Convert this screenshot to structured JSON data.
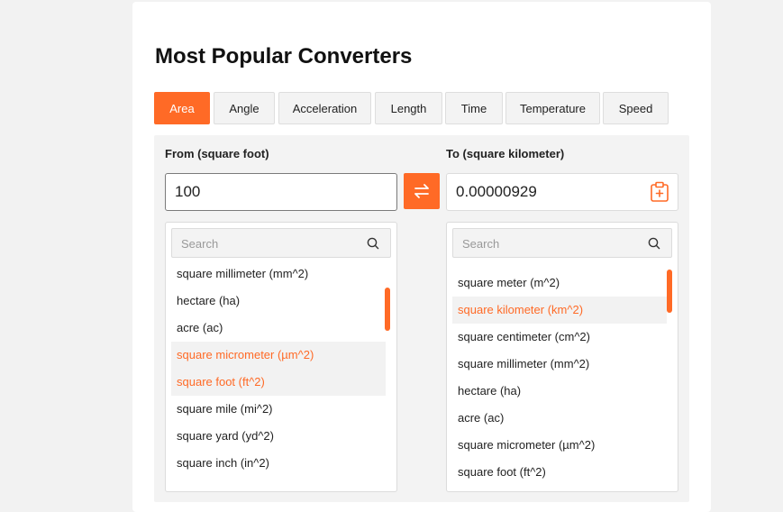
{
  "title": "Most Popular Converters",
  "tabs": [
    "Area",
    "Angle",
    "Acceleration",
    "Length",
    "Time",
    "Temperature",
    "Speed"
  ],
  "active_tab": "Area",
  "from": {
    "label": "From (square foot)",
    "value": "100",
    "search_placeholder": "Search",
    "items": [
      "square millimeter (mm^2)",
      "hectare (ha)",
      "acre (ac)",
      "square micrometer (µm^2)",
      "square foot (ft^2)",
      "square mile (mi^2)",
      "square yard (yd^2)",
      "square inch (in^2)"
    ],
    "highlighted": [
      "square micrometer (µm^2)",
      "square foot (ft^2)"
    ]
  },
  "to": {
    "label": "To (square kilometer)",
    "value": "0.00000929",
    "search_placeholder": "Search",
    "items": [
      "square meter (m^2)",
      "square kilometer (km^2)",
      "square centimeter (cm^2)",
      "square millimeter (mm^2)",
      "hectare (ha)",
      "acre (ac)",
      "square micrometer (µm^2)",
      "square foot (ft^2)"
    ],
    "highlighted": [
      "square kilometer (km^2)"
    ]
  },
  "colors": {
    "accent": "#ff6a26",
    "panel": "#f3f3f3"
  },
  "icons": {
    "swap": "swap-arrows-icon",
    "copy": "clipboard-plus-icon",
    "search": "search-icon"
  }
}
